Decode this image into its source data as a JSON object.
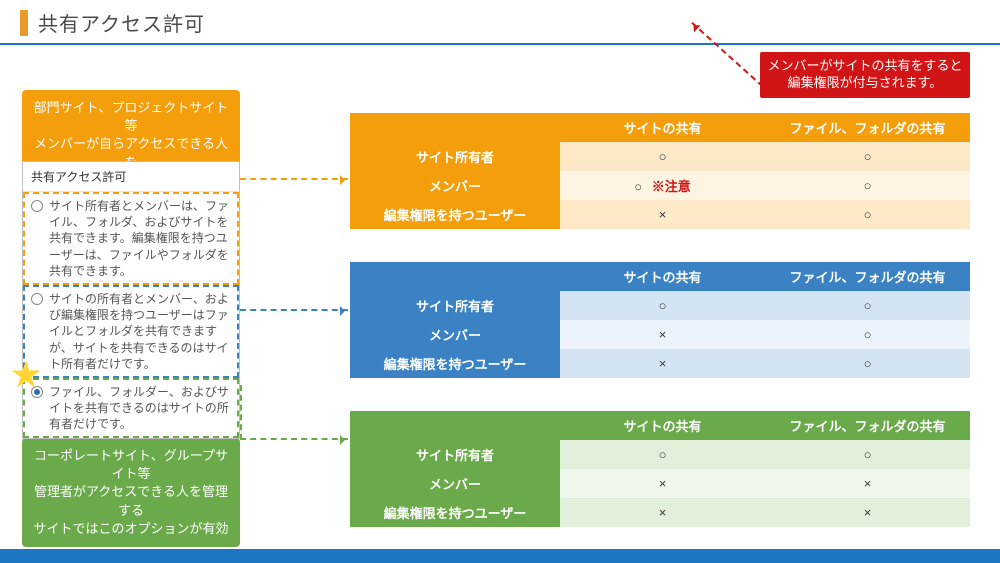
{
  "title": "共有アクセス許可",
  "warning_box": "メンバーがサイトの共有をすると\n編集権限が付与されます。",
  "callout_orange": "部門サイト、プロジェクトサイト等\nメンバーが自らアクセスできる人を\n管理するサイトはこのオプションが有効",
  "callout_green": "コーポレートサイト、グループサイト等\n管理者がアクセスできる人を管理する\nサイトではこのオプションが有効",
  "option_panel": {
    "heading": "共有アクセス許可",
    "options": [
      "サイト所有者とメンバーは、ファイル、フォルダ、およびサイトを共有できます。編集権限を持つユーザーは、ファイルやフォルダを共有できます。",
      "サイトの所有者とメンバー、および編集権限を持つユーザーはファイルとフォルダを共有できますが、サイトを共有できるのはサイト所有者だけです。",
      "ファイル、フォルダー、およびサイトを共有できるのはサイトの所有者だけです。"
    ]
  },
  "table_headers": {
    "empty": "",
    "col1": "サイトの共有",
    "col2": "ファイル、フォルダの共有"
  },
  "row_labels": {
    "owner": "サイト所有者",
    "member": "メンバー",
    "editor": "編集権限を持つユーザー"
  },
  "marks": {
    "yes": "○",
    "no": "×"
  },
  "warn_tag": "※注意",
  "chart_data": [
    {
      "option_index": 0,
      "color": "orange",
      "rows": [
        {
          "role": "サイト所有者",
          "site_share": "○",
          "file_share": "○"
        },
        {
          "role": "メンバー",
          "site_share": "○",
          "file_share": "○",
          "warning": true
        },
        {
          "role": "編集権限を持つユーザー",
          "site_share": "×",
          "file_share": "○"
        }
      ]
    },
    {
      "option_index": 1,
      "color": "blue",
      "rows": [
        {
          "role": "サイト所有者",
          "site_share": "○",
          "file_share": "○"
        },
        {
          "role": "メンバー",
          "site_share": "×",
          "file_share": "○"
        },
        {
          "role": "編集権限を持つユーザー",
          "site_share": "×",
          "file_share": "○"
        }
      ]
    },
    {
      "option_index": 2,
      "color": "green",
      "rows": [
        {
          "role": "サイト所有者",
          "site_share": "○",
          "file_share": "○"
        },
        {
          "role": "メンバー",
          "site_share": "×",
          "file_share": "×"
        },
        {
          "role": "編集権限を持つユーザー",
          "site_share": "×",
          "file_share": "×"
        }
      ]
    }
  ]
}
